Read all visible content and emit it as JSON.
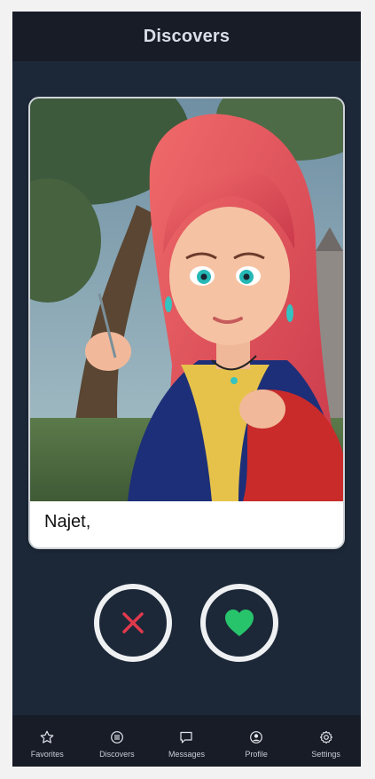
{
  "header": {
    "title": "Discovers"
  },
  "profile_card": {
    "name": "Najet,",
    "photo": "illustrated-red-haired-woman-portrait"
  },
  "actions": {
    "dislike_icon": "close-icon",
    "like_icon": "heart-icon",
    "dislike_color": "#e0394d",
    "like_color": "#27c46b"
  },
  "tabbar": {
    "items": [
      {
        "label": "Favorites",
        "icon": "star-icon"
      },
      {
        "label": "Discovers",
        "icon": "list-circle-icon"
      },
      {
        "label": "Messages",
        "icon": "chat-icon"
      },
      {
        "label": "Profile",
        "icon": "user-circle-icon"
      },
      {
        "label": "Settings",
        "icon": "gear-icon"
      }
    ]
  },
  "colors": {
    "background": "#1c2838",
    "bar": "#171c27",
    "card": "#ffffff"
  }
}
